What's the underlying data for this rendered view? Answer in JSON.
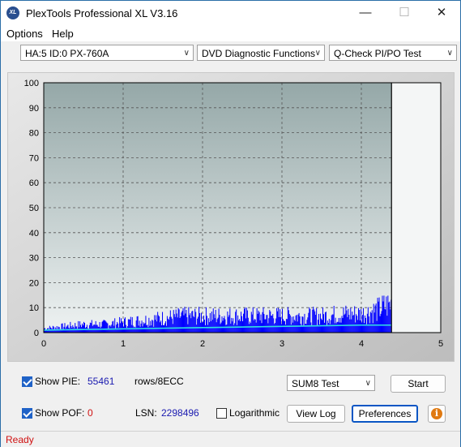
{
  "window": {
    "title": "PlexTools Professional XL V3.16",
    "icon_text": "XL"
  },
  "controls": {
    "minimize": "—",
    "maximize": "☐",
    "close": "✕"
  },
  "menu": [
    {
      "label": "Options"
    },
    {
      "label": "Help"
    }
  ],
  "toolbar": {
    "drive": "HA:5 ID:0  PX-760A",
    "function": "DVD Diagnostic Functions",
    "test": "Q-Check PI/PO Test"
  },
  "chart_data": {
    "type": "bar",
    "series": [
      {
        "name": "",
        "kind": "PIE rows/8ECC",
        "color": "#0000ff",
        "x": [
          0,
          0.25,
          0.5,
          0.75,
          1.0,
          1.25,
          1.5,
          1.75,
          2.0,
          2.25,
          2.5,
          2.75,
          3.0,
          3.25,
          3.5,
          3.75,
          4.0,
          4.1,
          4.2,
          4.3,
          4.38
        ],
        "values": [
          2,
          3,
          4,
          4,
          5,
          6,
          7,
          8,
          8,
          8,
          8,
          8,
          8,
          8,
          8,
          9,
          9,
          10,
          11,
          13,
          14
        ]
      },
      {
        "name": "",
        "kind": "cumulative line",
        "color": "#30e0e0",
        "x": [
          0,
          1,
          2,
          3,
          4,
          4.38
        ],
        "values": [
          1,
          1.5,
          2,
          2.5,
          3,
          3
        ]
      }
    ],
    "xlim": [
      0,
      5
    ],
    "ylim": [
      0,
      100
    ],
    "x_ticks": [
      "0",
      "1",
      "2",
      "3",
      "4",
      "5"
    ],
    "y_ticks": [
      "0",
      "10",
      "20",
      "30",
      "40",
      "50",
      "60",
      "70",
      "80",
      "90",
      "100"
    ],
    "end_marker_x": 4.38,
    "grid": true
  },
  "stats": {
    "show_pie_label": "Show PIE:",
    "pie_value": "55461",
    "pie_unit": "rows/8ECC",
    "show_pof_label": "Show POF:",
    "pof_value": "0",
    "lsn_label": "LSN:",
    "lsn_value": "2298496",
    "log_label": "Logarithmic",
    "test_select": "SUM8 Test",
    "start_label": "Start",
    "viewlog_label": "View Log",
    "prefs_label": "Preferences",
    "info_glyph": "i"
  },
  "status": {
    "text": "Ready"
  }
}
